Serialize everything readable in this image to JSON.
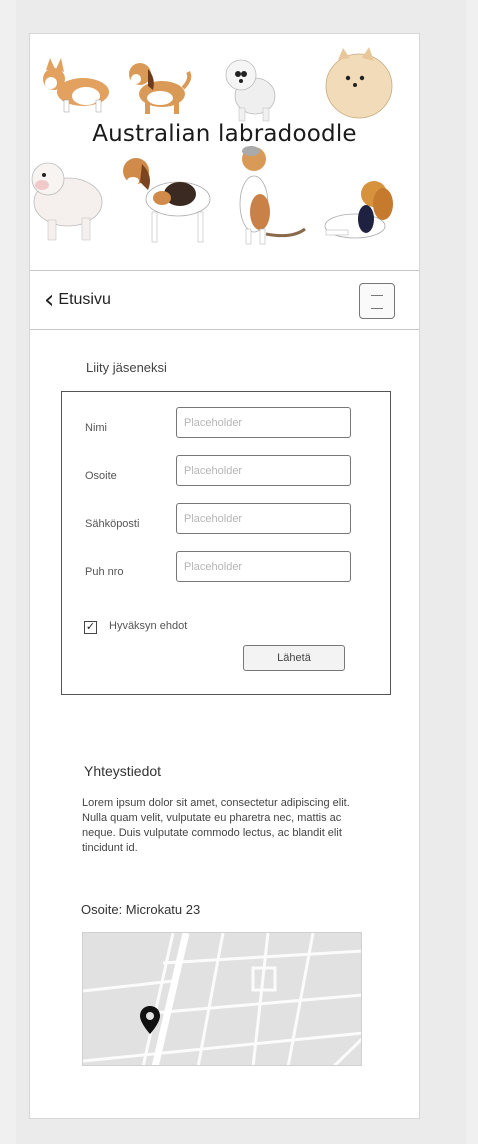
{
  "hero": {
    "title": "Australian labradoodle"
  },
  "nav": {
    "back_label": "Etusivu",
    "back_icon": "chevron-left-icon",
    "menu_icon": "hamburger-menu-icon"
  },
  "join": {
    "title": "Liity jäseneksi",
    "fields": [
      {
        "label": "Nimi",
        "placeholder": "Placeholder"
      },
      {
        "label": "Osoite",
        "placeholder": "Placeholder"
      },
      {
        "label": "Sähköposti",
        "placeholder": "Placeholder"
      },
      {
        "label": "Puh nro",
        "placeholder": "Placeholder"
      }
    ],
    "terms_label": "Hyväksyn ehdot",
    "terms_checked": true,
    "submit_label": "Lähetä"
  },
  "contact": {
    "title": "Yhteystiedot",
    "body": "Lorem ipsum dolor sit amet, consectetur adipiscing elit. Nulla quam velit, vulputate eu pharetra nec, mattis ac neque. Duis vulputate commodo lectus, ac blandit elit tincidunt id.",
    "address": "Osoite: Microkatu 23",
    "map_icon": "map-pin-icon"
  }
}
